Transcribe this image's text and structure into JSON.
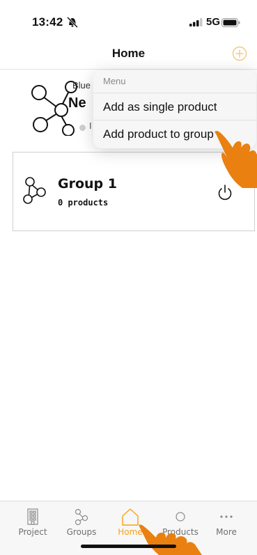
{
  "status_bar": {
    "time": "13:42",
    "network": "5G"
  },
  "nav": {
    "title": "Home",
    "add_icon": "plus-circle-icon"
  },
  "colors": {
    "accent": "#f5a217",
    "hand": "#e9800f"
  },
  "product_card": {
    "subtitle": "Blue",
    "name": "Ne",
    "status": "I"
  },
  "group_card": {
    "name": "Group 1",
    "count": "0 products"
  },
  "menu": {
    "header": "Menu",
    "items": [
      {
        "label": "Add as single product"
      },
      {
        "label": "Add product to group"
      }
    ]
  },
  "tabs": [
    {
      "label": "Project",
      "icon": "building-icon"
    },
    {
      "label": "Groups",
      "icon": "groups-icon"
    },
    {
      "label": "Home",
      "icon": "home-icon",
      "active": true
    },
    {
      "label": "Products",
      "icon": "product-circle-icon"
    },
    {
      "label": "More",
      "icon": "ellipsis-icon"
    }
  ]
}
